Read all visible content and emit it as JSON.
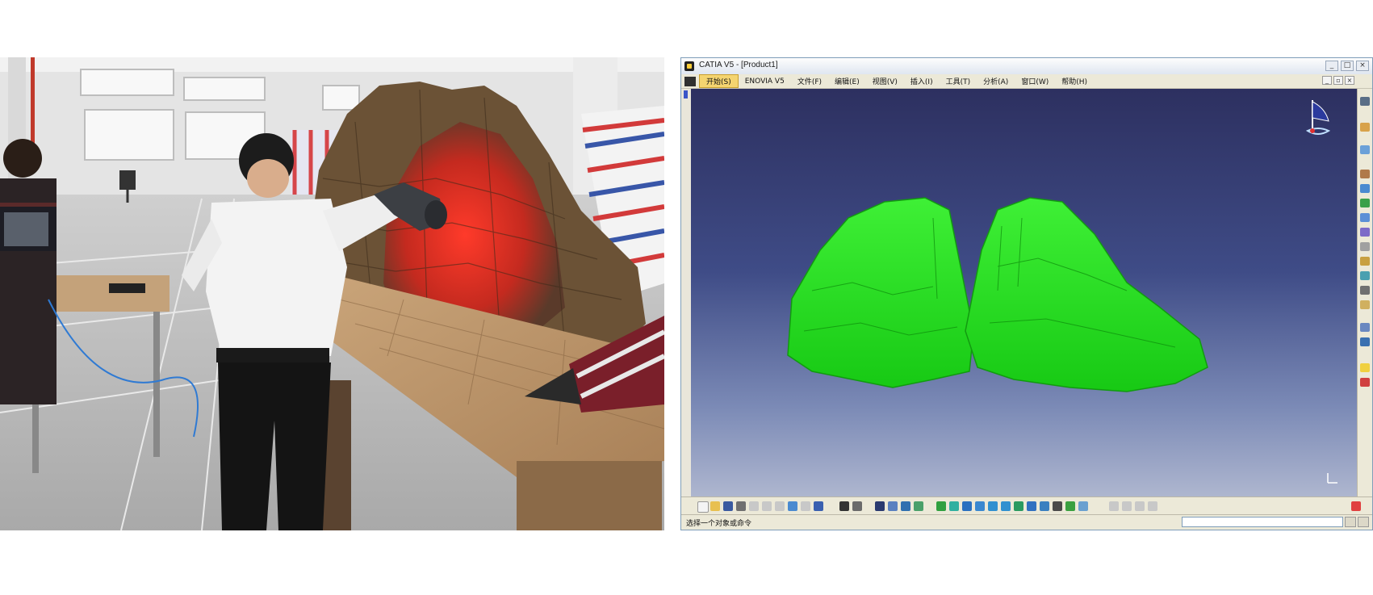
{
  "window": {
    "title": "CATIA V5 - [Product1]",
    "controls": [
      "_",
      "□",
      "×"
    ]
  },
  "menu": {
    "items": [
      {
        "label": "开始(S)",
        "active": true
      },
      {
        "label": "ENOVIA V5",
        "active": false
      },
      {
        "label": "文件(F)",
        "active": false
      },
      {
        "label": "编辑(E)",
        "active": false
      },
      {
        "label": "视图(V)",
        "active": false
      },
      {
        "label": "插入(I)",
        "active": false
      },
      {
        "label": "工具(T)",
        "active": false
      },
      {
        "label": "分析(A)",
        "active": false
      },
      {
        "label": "窗口(W)",
        "active": false
      },
      {
        "label": "帮助(H)",
        "active": false
      }
    ]
  },
  "status": {
    "prompt": "选择一个对象或命令"
  },
  "colors": {
    "model_green": "#22e81c",
    "active_menu": "#f4d470"
  },
  "icons": {
    "compass": "compass-icon",
    "axis": "axis-indicator-icon"
  }
}
